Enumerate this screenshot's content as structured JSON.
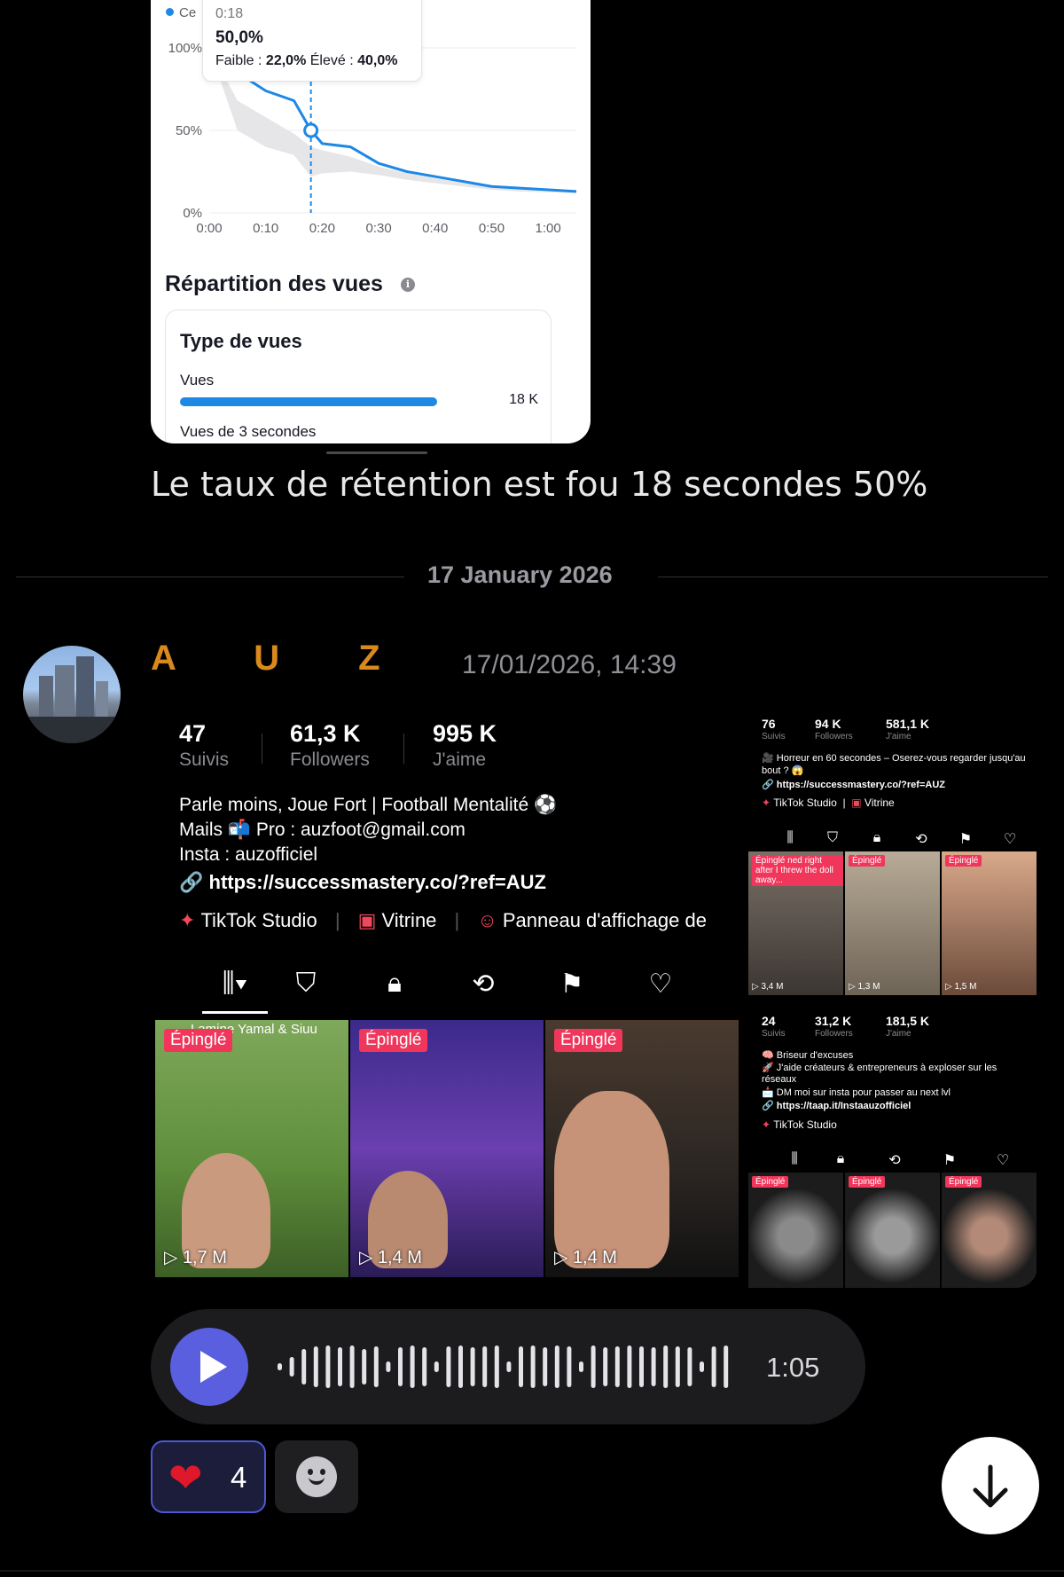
{
  "retention": {
    "legend_peek": "Ce",
    "tooltip": {
      "time": "0:18",
      "value": "50,0%",
      "low_label": "Faible :",
      "low_value": "22,0%",
      "high_label": "Élevé :",
      "high_value": "40,0%"
    },
    "y_ticks": [
      "100%",
      "50%",
      "0%"
    ],
    "x_ticks": [
      "0:00",
      "0:10",
      "0:20",
      "0:30",
      "0:40",
      "0:50",
      "1:00"
    ]
  },
  "chart_data": {
    "type": "line",
    "x": [
      "0:00",
      "0:05",
      "0:10",
      "0:15",
      "0:18",
      "0:20",
      "0:25",
      "0:30",
      "0:35",
      "0:40",
      "0:45",
      "0:50",
      "0:55",
      "1:05"
    ],
    "series": [
      {
        "values": [
          100,
          85,
          74,
          68,
          50,
          42,
          40,
          30,
          25,
          22,
          19,
          16,
          15,
          13
        ]
      }
    ],
    "band_low": [
      100,
      50,
      40,
      35,
      22,
      24,
      25,
      23,
      20,
      18,
      16,
      14,
      13,
      12
    ],
    "band_high": [
      100,
      68,
      58,
      48,
      40,
      38,
      34,
      28,
      24,
      21,
      18,
      16,
      15,
      14
    ],
    "ylim": [
      0,
      100
    ],
    "marker_x": "0:18"
  },
  "views": {
    "section_title": "Répartition des vues",
    "box_title": "Type de vues",
    "row1_label": "Vues",
    "row1_value": "18 K",
    "row1_fraction": 0.8,
    "row2_label": "Vues de 3 secondes"
  },
  "caption": "Le taux de rétention est fou 18 secondes 50%",
  "date_divider": "17 January 2026",
  "message": {
    "author": "A        U        Z",
    "timestamp": "17/01/2026, 14:39"
  },
  "profile_main": {
    "stats": [
      {
        "value": "47",
        "label": "Suivis"
      },
      {
        "value": "61,3 K",
        "label": "Followers"
      },
      {
        "value": "995 K",
        "label": "J'aime"
      }
    ],
    "bio": [
      "Parle moins, Joue Fort | Football Mentalité ⚽",
      "Mails 📬 Pro : auzfoot@gmail.com",
      "Insta : auzofficiel"
    ],
    "link": "https://successmastery.co/?ref=AUZ",
    "tools": [
      "TikTok Studio",
      "Vitrine",
      "Panneau d'affichage de"
    ],
    "tiles": [
      {
        "pin": "Épinglé",
        "views": "1,7 M",
        "caption": "Lamine Yamal & Siuu"
      },
      {
        "pin": "Épinglé",
        "views": "1,4 M"
      },
      {
        "pin": "Épinglé",
        "views": "1,4 M"
      }
    ]
  },
  "profile_a": {
    "stats": [
      {
        "value": "76",
        "label": "Suivis"
      },
      {
        "value": "94 K",
        "label": "Followers"
      },
      {
        "value": "581,1 K",
        "label": "J'aime"
      }
    ],
    "bio": [
      "🎥 Horreur en 60 secondes – Oserez-vous regarder jusqu'au",
      "bout ? 😱"
    ],
    "link": "https://successmastery.co/?ref=AUZ",
    "tools": [
      "TikTok Studio",
      "Vitrine"
    ],
    "tiles": [
      {
        "pin": "Épinglé",
        "views": "3,4 M",
        "caption": "ned right after I threw the doll away..."
      },
      {
        "pin": "Épinglé",
        "views": "1,3 M"
      },
      {
        "pin": "Épinglé",
        "views": "1,5 M"
      }
    ]
  },
  "profile_b": {
    "stats": [
      {
        "value": "24",
        "label": "Suivis"
      },
      {
        "value": "31,2 K",
        "label": "Followers"
      },
      {
        "value": "181,5 K",
        "label": "J'aime"
      }
    ],
    "bio": [
      "🧠 Briseur d'excuses",
      "🚀 J'aide créateurs & entrepreneurs à exploser sur les",
      "réseaux",
      "📩 DM moi sur insta pour passer au next lvl"
    ],
    "link": "https://taap.it/Instaauzofficiel",
    "tools": [
      "TikTok Studio"
    ],
    "tiles": [
      {
        "pin": "Épinglé"
      },
      {
        "pin": "Épinglé"
      },
      {
        "pin": "Épinglé"
      }
    ]
  },
  "voice_note": {
    "duration": "1:05"
  },
  "reactions": [
    {
      "emoji": "❤",
      "count": "4"
    }
  ]
}
